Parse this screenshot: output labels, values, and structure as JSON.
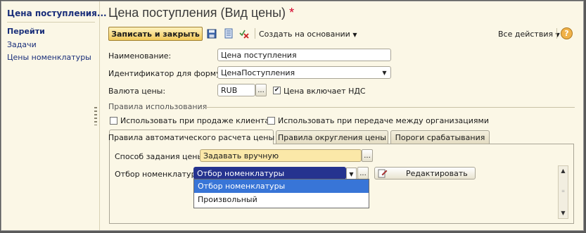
{
  "sidebar": {
    "title": "Цена поступления...",
    "section": "Перейти",
    "items": [
      {
        "label": "Задачи"
      },
      {
        "label": "Цены номенклатуры"
      }
    ]
  },
  "header": {
    "title": "Цена поступления (Вид цены)",
    "modified_marker": "*"
  },
  "toolbar": {
    "save_close_label": "Записать и закрыть",
    "create_basis_label": "Создать на основании",
    "all_actions_label": "Все действия",
    "help_label": "?"
  },
  "form": {
    "name_label": "Наименование:",
    "name_value": "Цена поступления",
    "formula_id_label": "Идентификатор для формул:",
    "formula_id_value": "ЦенаПоступления",
    "currency_label": "Валюта цены:",
    "currency_value": "RUB",
    "vat_included_label": "Цена включает НДС",
    "vat_included_checked": true,
    "usage_group_title": "Правила использования",
    "use_sales_label": "Использовать при продаже клиентам",
    "use_sales_checked": false,
    "use_transfer_label": "Использовать при передаче между организациями",
    "use_transfer_checked": false
  },
  "tabs": [
    {
      "label": "Правила автоматического расчета цены",
      "active": true
    },
    {
      "label": "Правила округления цены",
      "active": false
    },
    {
      "label": "Пороги срабатывания",
      "active": false
    }
  ],
  "tab_content": {
    "method_label": "Способ задания цены:",
    "method_value": "Задавать вручную",
    "filter_label": "Отбор номенклатуры:",
    "filter_value": "Отбор номенклатуры",
    "edit_label": "Редактировать",
    "dropdown_options": [
      {
        "label": "Отбор номенклатуры",
        "selected": true
      },
      {
        "label": "Произвольный",
        "selected": false
      }
    ]
  },
  "colors": {
    "accent_red": "#d4002a",
    "link_blue": "#1a2f7a",
    "selection_blue": "#3875d7",
    "primary_button_yellow": "#f1c95a"
  }
}
